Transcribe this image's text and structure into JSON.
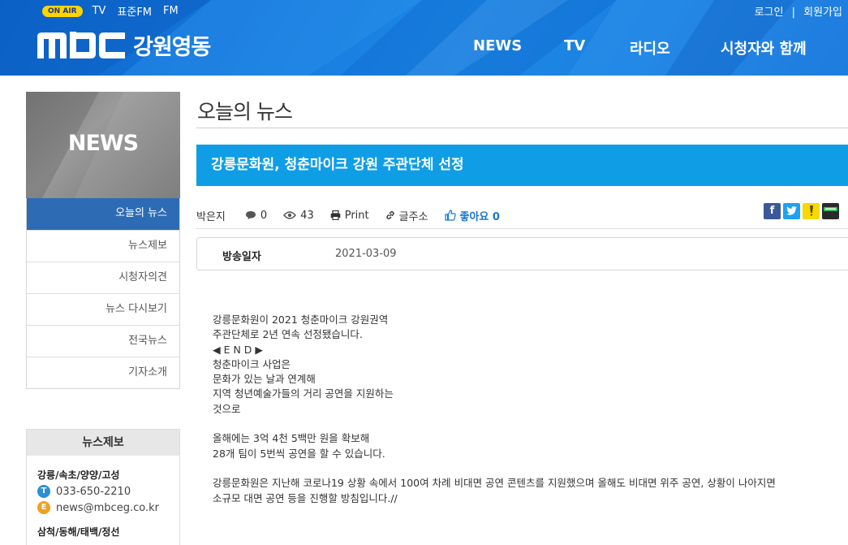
{
  "header": {
    "onair": "ON AIR",
    "top_links": [
      "TV",
      "표준FM",
      "FM"
    ],
    "login": "로그인",
    "separator": "|",
    "join": "회원가입",
    "logo_text": "mBC",
    "logo_region": "강원영동",
    "nav": [
      "NEWS",
      "TV",
      "라디오",
      "시청자와 함께"
    ]
  },
  "sidebar": {
    "banner_title": "NEWS",
    "menu": [
      "오늘의 뉴스",
      "뉴스제보",
      "시청자의견",
      "뉴스 다시보기",
      "전국뉴스",
      "기자소개"
    ],
    "tip": {
      "title": "뉴스제보",
      "region1": "강릉/속초/양양/고성",
      "phone_badge": "T",
      "phone": "033-650-2210",
      "email_badge": "E",
      "email": "news@mbceg.co.kr",
      "region2": "삼척/동해/태백/정선"
    }
  },
  "main": {
    "page_title": "오늘의 뉴스",
    "headline": "강릉문화원, 청춘마이크 강원 주관단체 선정",
    "meta": {
      "reporter": "박은지",
      "comments": "0",
      "views": "43",
      "print": "Print",
      "shortlink": "글주소",
      "like": "좋아요 0"
    },
    "info": {
      "label": "방송일자",
      "date": "2021-03-09"
    },
    "article_lines": [
      "강릉문화원이 2021 청춘마이크 강원권역",
      "주관단체로 2년 연속 선정됐습니다.",
      "◀ E N D ▶",
      "청춘마이크 사업은",
      "문화가 있는 날과 연계해",
      "지역 청년예술가들의 거리 공연을 지원하는",
      "것으로",
      "",
      "올해에는 3억 4천 5백만 원을 확보해",
      "28개 팀이 5번씩 공연을 할 수 있습니다.",
      "",
      "강릉문화원은 지난해 코로나19 상황 속에서 100여 차례 비대면 공연 콘텐츠를 지원했으며 올해도 비대면 위주 공연, 상황이 나아지면",
      "소규모 대면 공연 등을 진행할 방침입니다.//"
    ]
  },
  "colors": {
    "header_blue": "#1677dd",
    "headline_blue": "#0f9ee6",
    "menu_active": "#2d6cb5",
    "onair_yellow": "#ffd400",
    "like_blue": "#1a78c8"
  },
  "icons": {
    "comments": "speech-bubble-icon",
    "views": "eye-icon",
    "print": "printer-icon",
    "shortlink": "link-icon",
    "like": "thumbs-up-icon",
    "share": [
      "facebook-icon",
      "twitter-icon",
      "kakaostory-icon",
      "band-icon"
    ]
  }
}
